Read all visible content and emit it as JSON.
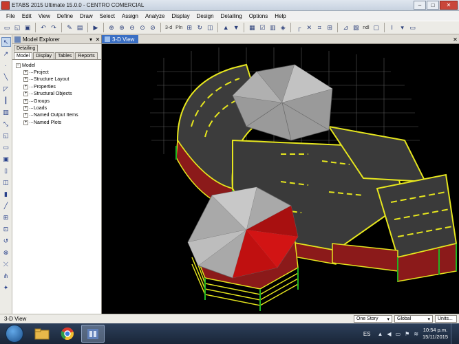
{
  "window": {
    "title": "ETABS 2015 Ultimate 15.0.0 - CENTRO COMERCIAL",
    "controls": {
      "minimize": "–",
      "maximize": "□",
      "close": "✕"
    }
  },
  "menu": [
    "File",
    "Edit",
    "View",
    "Define",
    "Draw",
    "Select",
    "Assign",
    "Analyze",
    "Display",
    "Design",
    "Detailing",
    "Options",
    "Help"
  ],
  "toolbar": {
    "view_3d_label": "3-d",
    "plan_label": "Pln",
    "elev_label": "ndl"
  },
  "explorer": {
    "title": "Model Explorer",
    "pin_icon": "▾",
    "close_icon": "✕",
    "top_tab": "Detailing",
    "tabs": [
      "Model",
      "Display",
      "Tables",
      "Reports"
    ],
    "active_tab": "Model",
    "tree": {
      "root": {
        "toggle": "−",
        "label": "Model"
      },
      "children": [
        {
          "toggle": "+",
          "label": "Project"
        },
        {
          "toggle": "+",
          "label": "Structure Layout"
        },
        {
          "toggle": "+",
          "label": "Properties"
        },
        {
          "toggle": "+",
          "label": "Structural Objects"
        },
        {
          "toggle": "+",
          "label": "Groups"
        },
        {
          "toggle": "+",
          "label": "Loads"
        },
        {
          "toggle": "+",
          "label": "Named Output Items"
        },
        {
          "toggle": "+",
          "label": "Named Plots"
        }
      ]
    }
  },
  "viewport": {
    "tab_label": "3-D View",
    "close_icon": "✕"
  },
  "status": {
    "text": "3-D View",
    "story_select": "One Story",
    "coord_select": "Global",
    "units_button": "Units..."
  },
  "taskbar": {
    "apps": [
      "file-explorer-icon",
      "chrome-icon",
      "etabs-icon"
    ],
    "language": "ES",
    "time": "10:54 p.m.",
    "date": "15/11/2015"
  },
  "colors": {
    "model_roof": "#b8b8b8",
    "model_highlight": "#d21414",
    "beam_yellow": "#e6e61e",
    "column_green": "#21b521",
    "slab_dark": "#3c3c3c",
    "wall_red": "#8b1a1a",
    "tab_active_blue": "#3a6fc4"
  }
}
